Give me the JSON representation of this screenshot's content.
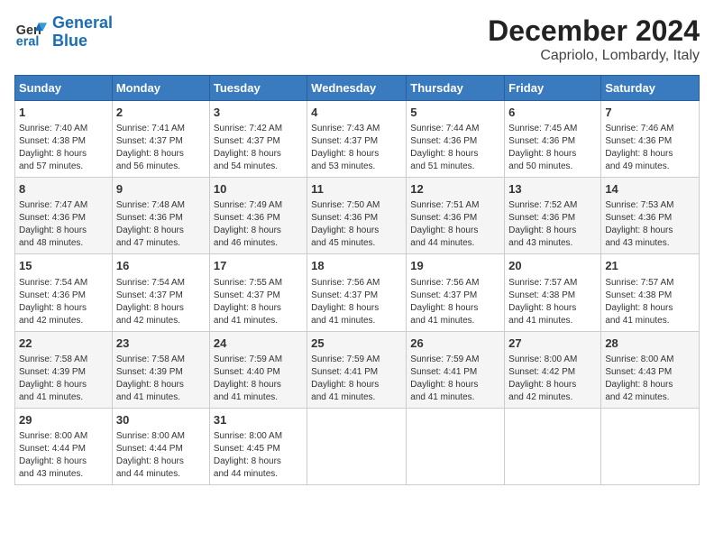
{
  "header": {
    "logo_line1": "General",
    "logo_line2": "Blue",
    "title": "December 2024",
    "subtitle": "Capriolo, Lombardy, Italy"
  },
  "columns": [
    "Sunday",
    "Monday",
    "Tuesday",
    "Wednesday",
    "Thursday",
    "Friday",
    "Saturday"
  ],
  "weeks": [
    [
      {
        "day": "1",
        "sunrise": "7:40 AM",
        "sunset": "4:38 PM",
        "daylight": "8 hours and 57 minutes."
      },
      {
        "day": "2",
        "sunrise": "7:41 AM",
        "sunset": "4:37 PM",
        "daylight": "8 hours and 56 minutes."
      },
      {
        "day": "3",
        "sunrise": "7:42 AM",
        "sunset": "4:37 PM",
        "daylight": "8 hours and 54 minutes."
      },
      {
        "day": "4",
        "sunrise": "7:43 AM",
        "sunset": "4:37 PM",
        "daylight": "8 hours and 53 minutes."
      },
      {
        "day": "5",
        "sunrise": "7:44 AM",
        "sunset": "4:36 PM",
        "daylight": "8 hours and 51 minutes."
      },
      {
        "day": "6",
        "sunrise": "7:45 AM",
        "sunset": "4:36 PM",
        "daylight": "8 hours and 50 minutes."
      },
      {
        "day": "7",
        "sunrise": "7:46 AM",
        "sunset": "4:36 PM",
        "daylight": "8 hours and 49 minutes."
      }
    ],
    [
      {
        "day": "8",
        "sunrise": "7:47 AM",
        "sunset": "4:36 PM",
        "daylight": "8 hours and 48 minutes."
      },
      {
        "day": "9",
        "sunrise": "7:48 AM",
        "sunset": "4:36 PM",
        "daylight": "8 hours and 47 minutes."
      },
      {
        "day": "10",
        "sunrise": "7:49 AM",
        "sunset": "4:36 PM",
        "daylight": "8 hours and 46 minutes."
      },
      {
        "day": "11",
        "sunrise": "7:50 AM",
        "sunset": "4:36 PM",
        "daylight": "8 hours and 45 minutes."
      },
      {
        "day": "12",
        "sunrise": "7:51 AM",
        "sunset": "4:36 PM",
        "daylight": "8 hours and 44 minutes."
      },
      {
        "day": "13",
        "sunrise": "7:52 AM",
        "sunset": "4:36 PM",
        "daylight": "8 hours and 43 minutes."
      },
      {
        "day": "14",
        "sunrise": "7:53 AM",
        "sunset": "4:36 PM",
        "daylight": "8 hours and 43 minutes."
      }
    ],
    [
      {
        "day": "15",
        "sunrise": "7:54 AM",
        "sunset": "4:36 PM",
        "daylight": "8 hours and 42 minutes."
      },
      {
        "day": "16",
        "sunrise": "7:54 AM",
        "sunset": "4:37 PM",
        "daylight": "8 hours and 42 minutes."
      },
      {
        "day": "17",
        "sunrise": "7:55 AM",
        "sunset": "4:37 PM",
        "daylight": "8 hours and 41 minutes."
      },
      {
        "day": "18",
        "sunrise": "7:56 AM",
        "sunset": "4:37 PM",
        "daylight": "8 hours and 41 minutes."
      },
      {
        "day": "19",
        "sunrise": "7:56 AM",
        "sunset": "4:37 PM",
        "daylight": "8 hours and 41 minutes."
      },
      {
        "day": "20",
        "sunrise": "7:57 AM",
        "sunset": "4:38 PM",
        "daylight": "8 hours and 41 minutes."
      },
      {
        "day": "21",
        "sunrise": "7:57 AM",
        "sunset": "4:38 PM",
        "daylight": "8 hours and 41 minutes."
      }
    ],
    [
      {
        "day": "22",
        "sunrise": "7:58 AM",
        "sunset": "4:39 PM",
        "daylight": "8 hours and 41 minutes."
      },
      {
        "day": "23",
        "sunrise": "7:58 AM",
        "sunset": "4:39 PM",
        "daylight": "8 hours and 41 minutes."
      },
      {
        "day": "24",
        "sunrise": "7:59 AM",
        "sunset": "4:40 PM",
        "daylight": "8 hours and 41 minutes."
      },
      {
        "day": "25",
        "sunrise": "7:59 AM",
        "sunset": "4:41 PM",
        "daylight": "8 hours and 41 minutes."
      },
      {
        "day": "26",
        "sunrise": "7:59 AM",
        "sunset": "4:41 PM",
        "daylight": "8 hours and 41 minutes."
      },
      {
        "day": "27",
        "sunrise": "8:00 AM",
        "sunset": "4:42 PM",
        "daylight": "8 hours and 42 minutes."
      },
      {
        "day": "28",
        "sunrise": "8:00 AM",
        "sunset": "4:43 PM",
        "daylight": "8 hours and 42 minutes."
      }
    ],
    [
      {
        "day": "29",
        "sunrise": "8:00 AM",
        "sunset": "4:44 PM",
        "daylight": "8 hours and 43 minutes."
      },
      {
        "day": "30",
        "sunrise": "8:00 AM",
        "sunset": "4:44 PM",
        "daylight": "8 hours and 44 minutes."
      },
      {
        "day": "31",
        "sunrise": "8:00 AM",
        "sunset": "4:45 PM",
        "daylight": "8 hours and 44 minutes."
      },
      null,
      null,
      null,
      null
    ]
  ],
  "labels": {
    "sunrise": "Sunrise:",
    "sunset": "Sunset:",
    "daylight": "Daylight:"
  }
}
